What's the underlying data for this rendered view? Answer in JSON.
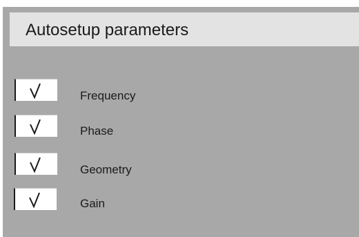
{
  "title": "Autosetup parameters",
  "colors": {
    "panel": "#a8a8a8",
    "title_bar": "#e3e3e3",
    "checkbox": "#ffffff",
    "text": "#1a1a1a"
  },
  "options": [
    {
      "label": "Frequency",
      "checked": true,
      "icon": "checkmark-icon"
    },
    {
      "label": "Phase",
      "checked": true,
      "icon": "checkmark-icon"
    },
    {
      "label": "Geometry",
      "checked": true,
      "icon": "checkmark-icon"
    },
    {
      "label": "Gain",
      "checked": true,
      "icon": "checkmark-icon"
    }
  ]
}
